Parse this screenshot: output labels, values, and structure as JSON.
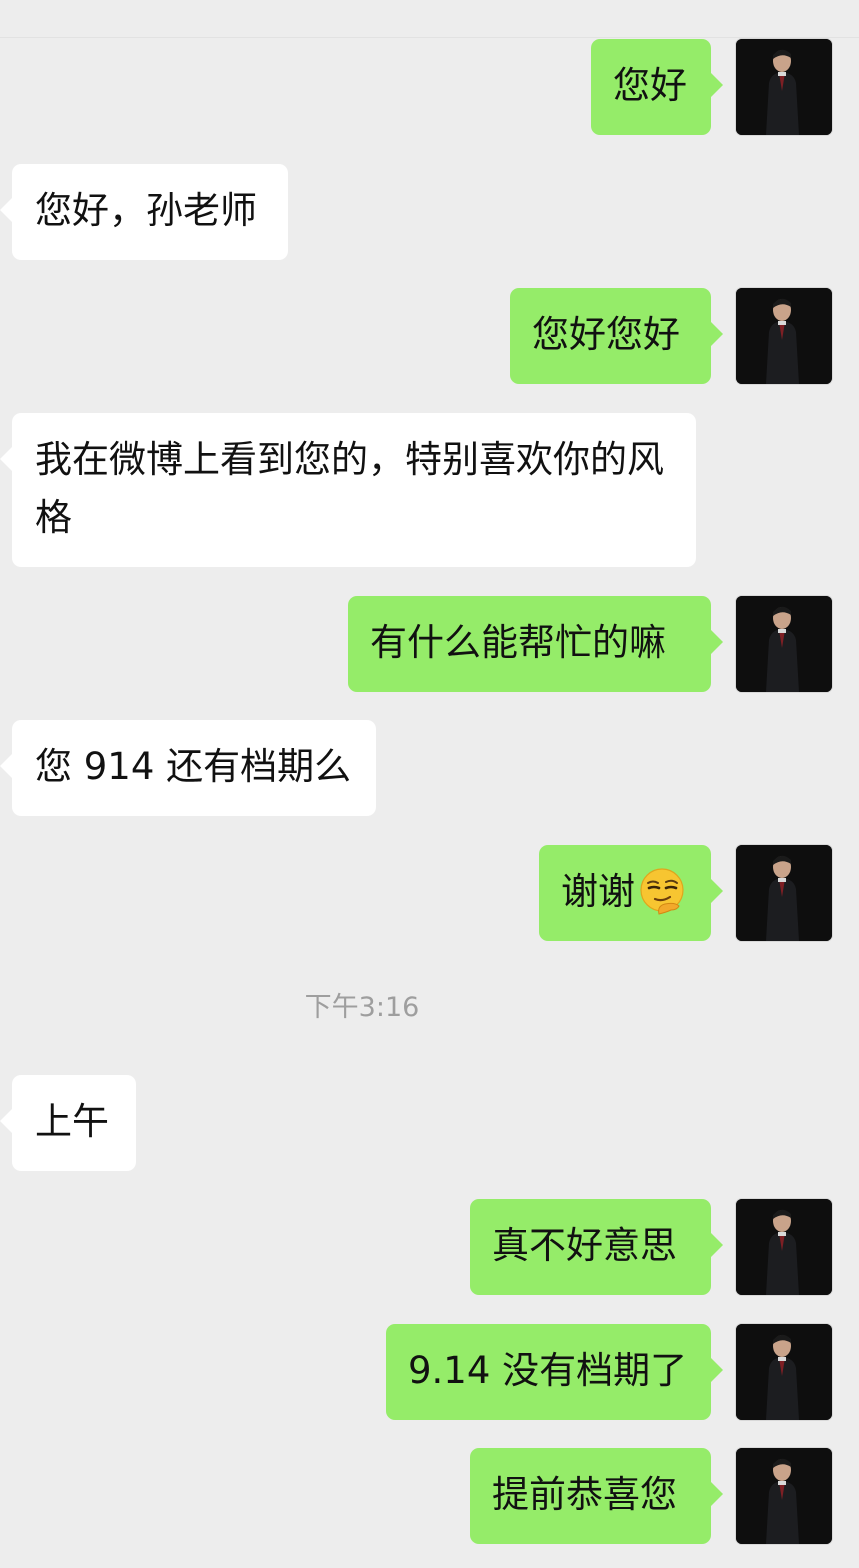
{
  "chat": {
    "messages": [
      {
        "side": "right",
        "text": "您好"
      },
      {
        "side": "left",
        "text": "您好，孙老师"
      },
      {
        "side": "right",
        "text": "您好您好"
      },
      {
        "side": "left",
        "text": "我在微博上看到您的，特别喜欢你的风格"
      },
      {
        "side": "right",
        "text": "有什么能帮忙的嘛"
      },
      {
        "side": "left",
        "text": "您 914 还有档期么"
      },
      {
        "side": "right",
        "text": "谢谢",
        "emoji": "smirk-hand-on-chin-emoji"
      },
      {
        "side": "left",
        "text": "上午"
      },
      {
        "side": "right",
        "text": "真不好意思"
      },
      {
        "side": "right",
        "text": "9.14 没有档期了"
      },
      {
        "side": "right",
        "text": "提前恭喜您"
      }
    ],
    "timestamp": "下午3:16"
  },
  "colors": {
    "background": "#ededed",
    "outgoing_bubble": "#95ec69",
    "incoming_bubble": "#ffffff",
    "timestamp_text": "#9e9e9e"
  },
  "icons": {
    "avatar": "profile-photo-man-in-dark-suit"
  }
}
